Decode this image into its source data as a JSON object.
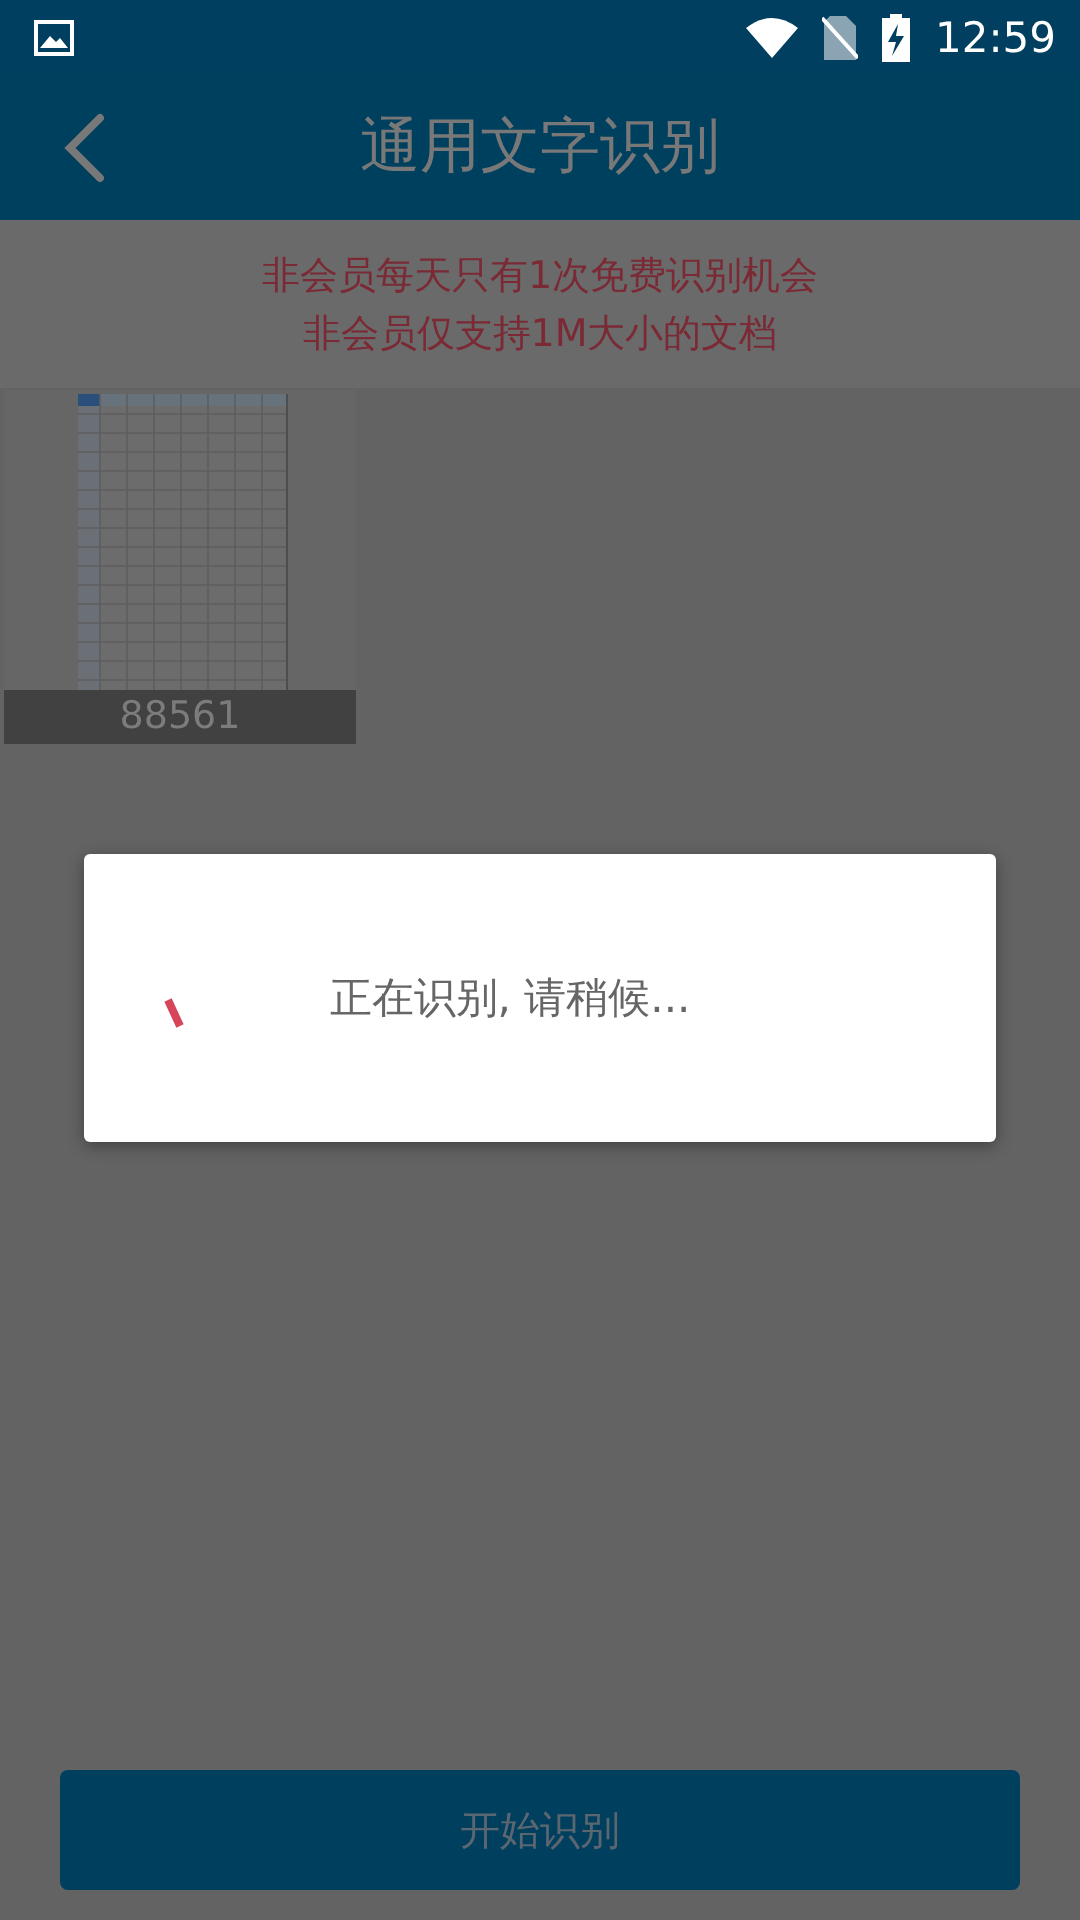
{
  "status_bar": {
    "time": "12:59"
  },
  "app_bar": {
    "title": "通用文字识别"
  },
  "notices": [
    "非会员每天只有1次免费识别机会",
    "非会员仅支持1M大小的文档"
  ],
  "documents": [
    {
      "kind": "picture",
      "caption": "88561"
    }
  ],
  "dialog": {
    "message": "正在识别, 请稍候..."
  },
  "start_button": {
    "label": "开始识别"
  }
}
